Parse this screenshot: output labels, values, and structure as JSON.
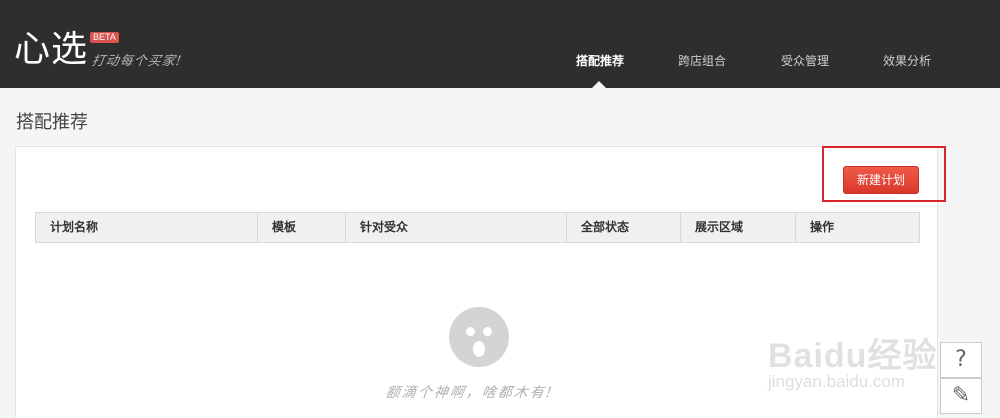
{
  "brand": {
    "logo": "心选",
    "badge": "BETA",
    "slogan": "打动每个买家!"
  },
  "nav": {
    "items": [
      {
        "label": "搭配推荐",
        "active": true
      },
      {
        "label": "跨店组合",
        "active": false
      },
      {
        "label": "受众管理",
        "active": false
      },
      {
        "label": "效果分析",
        "active": false
      }
    ]
  },
  "page": {
    "title": "搭配推荐",
    "new_plan_button": "新建计划"
  },
  "table": {
    "columns": [
      "计划名称",
      "模板",
      "针对受众",
      "全部状态",
      "展示区域",
      "操作"
    ]
  },
  "empty_state": {
    "message": "额滴个神啊，啥都木有!"
  },
  "watermark": {
    "logo": "Baidu经验",
    "url": "jingyan.baidu.com"
  },
  "side_tools": {
    "help": "?",
    "edit": "✎"
  },
  "colors": {
    "header_bg": "#2e2e2e",
    "primary_button": "#e74c3c",
    "highlight_border": "#d9262b"
  }
}
